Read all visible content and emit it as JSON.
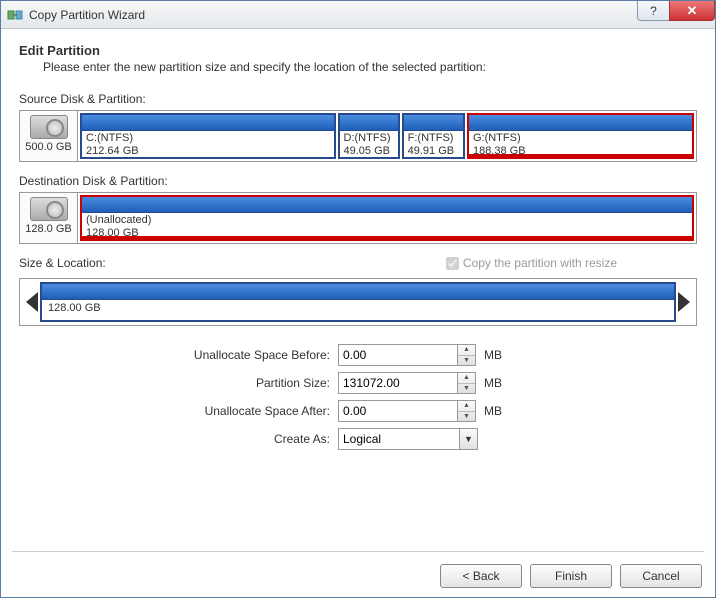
{
  "window": {
    "title": "Copy Partition Wizard"
  },
  "header": {
    "title": "Edit Partition",
    "subtitle": "Please enter the new partition size and specify the location of the selected partition:"
  },
  "source": {
    "label": "Source Disk & Partition:",
    "disk_capacity": "500.0 GB",
    "partitions": [
      {
        "name": "C:(NTFS)",
        "size": "212.64 GB",
        "flex": 212,
        "selected": false
      },
      {
        "name": "D:(NTFS)",
        "size": "49.05 GB",
        "flex": 49,
        "selected": false
      },
      {
        "name": "F:(NTFS)",
        "size": "49.91 GB",
        "flex": 50,
        "selected": false
      },
      {
        "name": "G:(NTFS)",
        "size": "188.38 GB",
        "flex": 188,
        "selected": true
      }
    ]
  },
  "dest": {
    "label": "Destination Disk & Partition:",
    "disk_capacity": "128.0 GB",
    "partitions": [
      {
        "name": "(Unallocated)",
        "size": "128.00 GB",
        "flex": 1,
        "selected": true
      }
    ]
  },
  "sizeloc": {
    "label": "Size & Location:",
    "checkbox_label": "Copy the partition with resize",
    "checkbox_checked": true,
    "resize_label": "128.00 GB"
  },
  "form": {
    "before_label": "Unallocate Space Before:",
    "before_value": "0.00",
    "size_label": "Partition Size:",
    "size_value": "131072.00",
    "after_label": "Unallocate Space After:",
    "after_value": "0.00",
    "unit": "MB",
    "create_label": "Create As:",
    "create_value": "Logical"
  },
  "footer": {
    "back": "< Back",
    "finish": "Finish",
    "cancel": "Cancel"
  }
}
